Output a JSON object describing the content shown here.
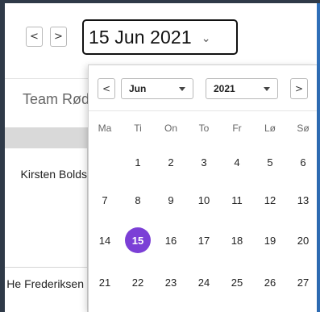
{
  "nav": {
    "prev_label": "<",
    "next_label": ">",
    "date_value": "15 Jun 2021",
    "caret": "⌄"
  },
  "schedule": {
    "team_label": "Team Rød",
    "people": [
      "Kirsten Bolds",
      "He Frederiksen"
    ]
  },
  "datepicker": {
    "prev_label": "<",
    "next_label": ">",
    "month": "Jun",
    "year": "2021",
    "weekdays": [
      "Ma",
      "Ti",
      "On",
      "To",
      "Fr",
      "Lø",
      "Sø"
    ],
    "weeks": [
      [
        "",
        "1",
        "2",
        "3",
        "4",
        "5",
        "6"
      ],
      [
        "7",
        "8",
        "9",
        "10",
        "11",
        "12",
        "13"
      ],
      [
        "14",
        "15",
        "16",
        "17",
        "18",
        "19",
        "20"
      ],
      [
        "21",
        "22",
        "23",
        "24",
        "25",
        "26",
        "27"
      ]
    ],
    "selected_day": "15",
    "accent_color": "#7b3fd6"
  }
}
